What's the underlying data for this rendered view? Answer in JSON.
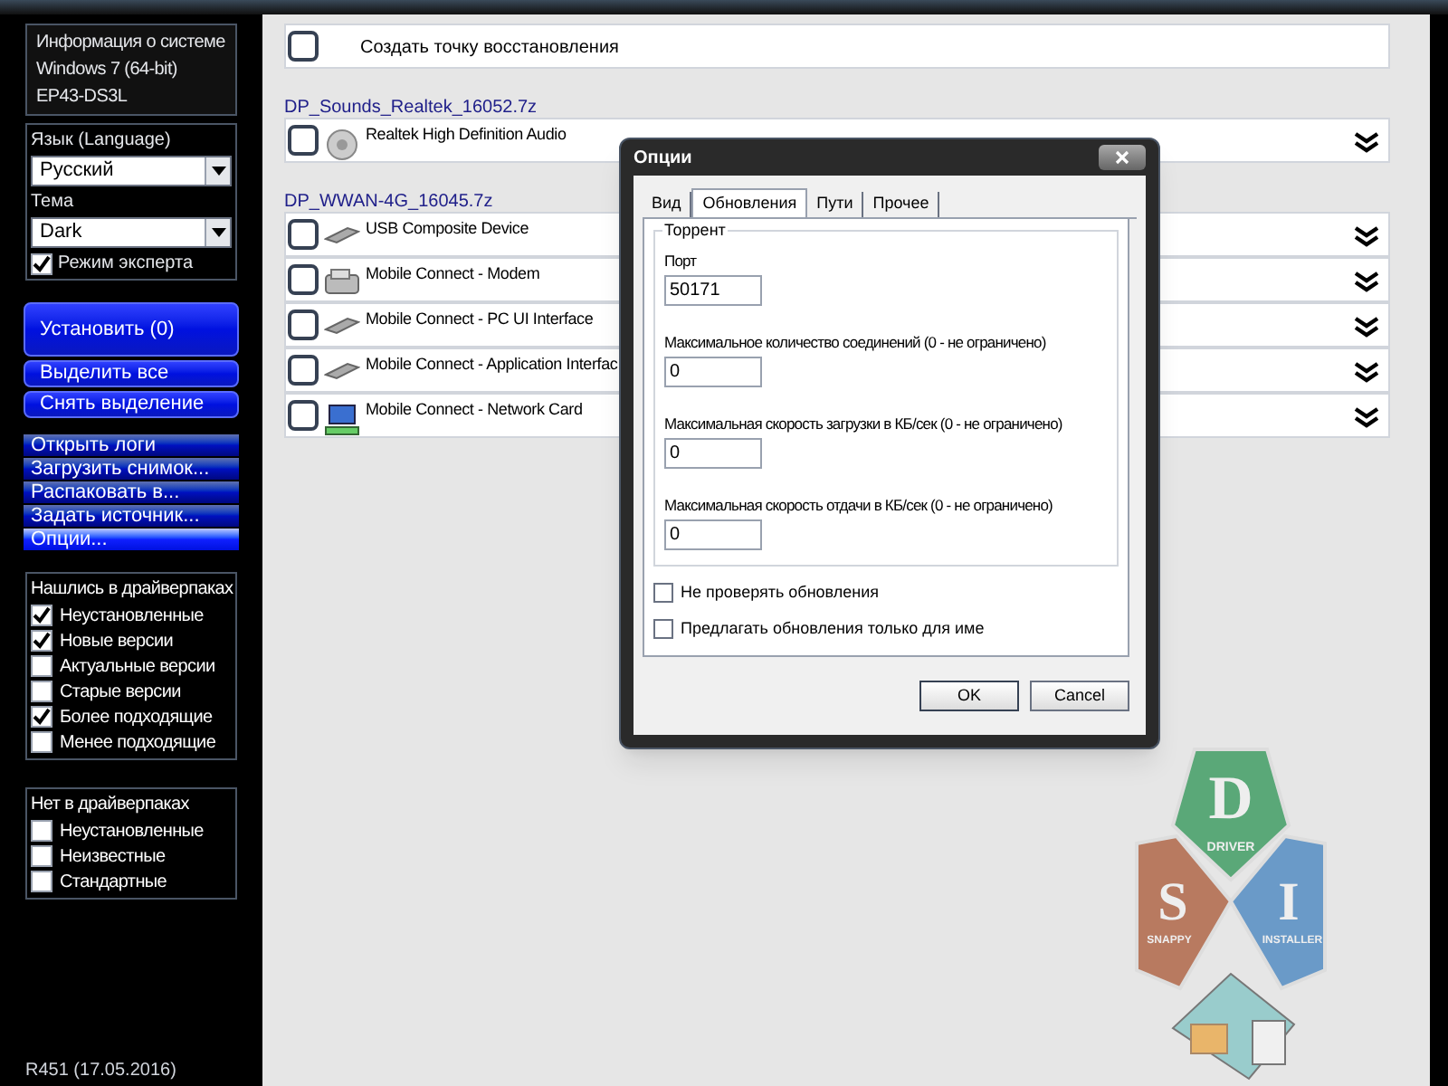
{
  "sidebar": {
    "system_info": [
      "Информация о системе",
      "Windows 7 (64-bit)",
      "EP43-DS3L"
    ],
    "language": {
      "label": "Язык (Language)",
      "value": "Русский"
    },
    "theme": {
      "label": "Тема",
      "value": "Dark"
    },
    "expert_mode": {
      "label": "Режим эксперта",
      "checked": true
    },
    "install_button": "Установить (0)",
    "select_buttons": [
      "Выделить все",
      "Снять выделение"
    ],
    "menu": [
      {
        "label": "Открыть логи",
        "selected": false
      },
      {
        "label": "Загрузить снимок...",
        "selected": false
      },
      {
        "label": "Распаковать в...",
        "selected": false
      },
      {
        "label": "Задать источник...",
        "selected": false
      },
      {
        "label": "Опции...",
        "selected": true
      }
    ],
    "found_filters": {
      "title": "Нашлись в драйверпаках",
      "items": [
        {
          "label": "Неустановленные",
          "checked": true
        },
        {
          "label": "Новые версии",
          "checked": true
        },
        {
          "label": "Актуальные версии",
          "checked": false
        },
        {
          "label": "Старые версии",
          "checked": false
        },
        {
          "label": "Более подходящие",
          "checked": true
        },
        {
          "label": "Менее подходящие",
          "checked": false
        }
      ]
    },
    "missing_filters": {
      "title": "Нет в драйверпаках",
      "items": [
        {
          "label": "Неустановленные",
          "checked": false
        },
        {
          "label": "Неизвестные",
          "checked": false
        },
        {
          "label": "Стандартные",
          "checked": false
        }
      ]
    },
    "version": "R451 (17.05.2016)"
  },
  "restore_point": {
    "label": "Создать точку восстановления",
    "checked": false
  },
  "driver_packs": [
    {
      "name": "DP_Sounds_Realtek_16052.7z",
      "devices": [
        {
          "name": "Realtek High Definition Audio",
          "kind": "audio",
          "checked": false
        }
      ]
    },
    {
      "name": "DP_WWAN-4G_16045.7z",
      "devices": [
        {
          "name": "USB Composite Device",
          "kind": "usb",
          "checked": false
        },
        {
          "name": "Mobile Connect - Modem",
          "kind": "modem",
          "checked": false
        },
        {
          "name": "Mobile Connect - PC UI Interface",
          "kind": "usb",
          "checked": false
        },
        {
          "name": "Mobile Connect - Application Interfac",
          "kind": "usb",
          "checked": false
        },
        {
          "name": "Mobile Connect - Network Card",
          "kind": "network",
          "checked": false
        }
      ]
    }
  ],
  "dialog": {
    "title": "Опции",
    "tabs": [
      {
        "label": "Вид",
        "selected": false
      },
      {
        "label": "Обновления",
        "selected": true
      },
      {
        "label": "Пути",
        "selected": false
      },
      {
        "label": "Прочее",
        "selected": false
      }
    ],
    "group_title": "Торрент",
    "fields": [
      {
        "label": "Порт",
        "value": "50171"
      },
      {
        "label": "Максимальное количество соединений (0 - не ограничено)",
        "value": "0"
      },
      {
        "label": "Максимальная скорость загрузки в КБ/сек (0 - не ограничено)",
        "value": "0"
      },
      {
        "label": "Максимальная скорость отдачи в КБ/сек (0 - не ограничено)",
        "value": "0"
      }
    ],
    "checkboxes": [
      {
        "label": "Не проверять обновления",
        "checked": false
      },
      {
        "label": "Предлагать обновления только для име",
        "checked": false
      }
    ],
    "buttons": [
      "OK",
      "Cancel"
    ]
  },
  "logo": [
    {
      "letter": "D",
      "word": "DRIVER",
      "color": "#5aa878"
    },
    {
      "letter": "S",
      "word": "SNAPPY",
      "color": "#b87a60"
    },
    {
      "letter": "I",
      "word": "INSTALLER",
      "color": "#6a9ac8"
    }
  ]
}
